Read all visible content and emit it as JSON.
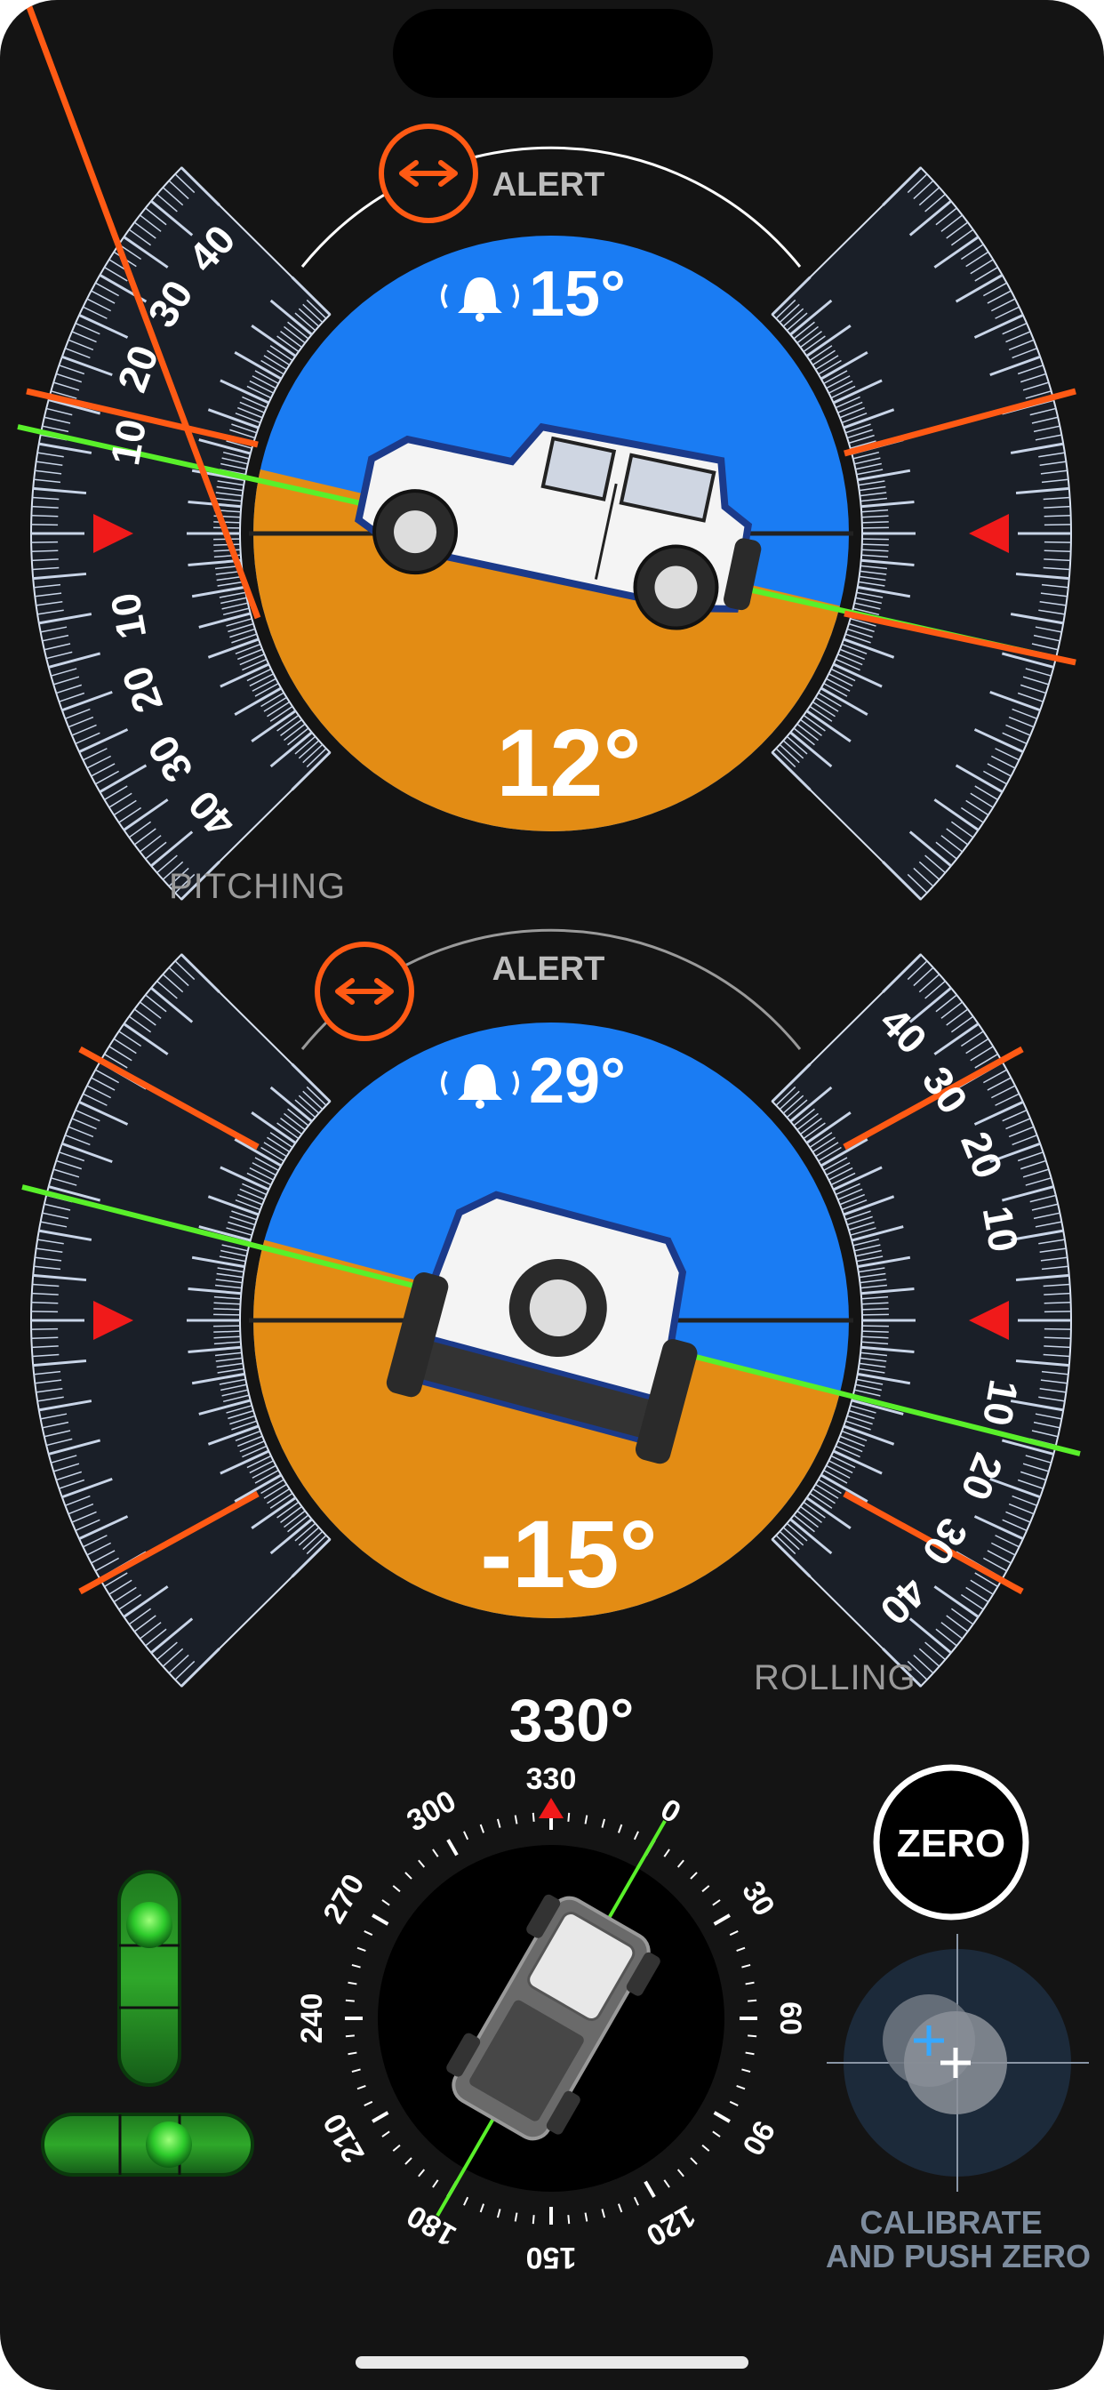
{
  "pitch": {
    "alert_label": "ALERT",
    "alert_value": "15°",
    "angle": "12°",
    "caption": "PITCHING",
    "scale_labels": [
      "10",
      "20",
      "30",
      "40"
    ]
  },
  "roll": {
    "alert_label": "ALERT",
    "alert_value": "29°",
    "angle": "-15°",
    "caption": "ROLLING",
    "scale_labels": [
      "10",
      "20",
      "30",
      "40"
    ]
  },
  "compass": {
    "heading": "330°",
    "ticks": [
      "0",
      "30",
      "60",
      "90",
      "120",
      "150",
      "180",
      "210",
      "240",
      "270",
      "300",
      "330"
    ]
  },
  "controls": {
    "zero_label": "ZERO",
    "calibrate_line1": "CALIBRATE",
    "calibrate_line2": "AND PUSH ZERO"
  },
  "colors": {
    "sky": "#1a7cf3",
    "ground": "#e38c14",
    "alert_orange": "#ff5a14",
    "level_green": "#59f02a",
    "marker_red": "#f01a1a",
    "bubble_green": "#1fae28"
  },
  "levels": {
    "pitch_deg": 12,
    "roll_deg": -15,
    "heading_deg": 330
  }
}
